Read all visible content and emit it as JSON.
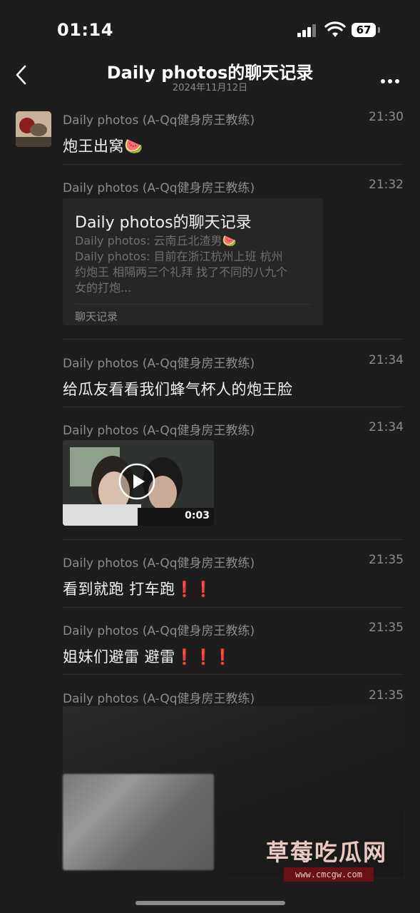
{
  "status": {
    "time": "01:14",
    "battery": "67"
  },
  "header": {
    "title": "Daily photos的聊天记录",
    "date": "2024年11月12日"
  },
  "messages": [
    {
      "name": "Daily photos (A-Qq健身房王教练)",
      "time": "21:30",
      "text": "炮王出窝🍉"
    },
    {
      "name": "Daily photos (A-Qq健身房王教练)",
      "time": "21:32",
      "card": {
        "title": "Daily photos的聊天记录",
        "line1": "Daily photos: 云南丘北渣男🍉",
        "line2": "Daily photos: 目前在浙江杭州上班 杭州",
        "line3": "约炮王 相隔两三个礼拜 找了不同的八九个",
        "line4": "女的打炮...",
        "footer": "聊天记录"
      }
    },
    {
      "name": "Daily photos (A-Qq健身房王教练)",
      "time": "21:34",
      "text": "给瓜友看看我们蜂气杯人的炮王脸"
    },
    {
      "name": "Daily photos (A-Qq健身房王教练)",
      "time": "21:34",
      "video_duration": "0:03"
    },
    {
      "name": "Daily photos (A-Qq健身房王教练)",
      "time": "21:35",
      "text": "看到就跑 打车跑❗️❗️"
    },
    {
      "name": "Daily photos (A-Qq健身房王教练)",
      "time": "21:35",
      "text": "姐妹们避雷 避雷❗️❗️❗️"
    },
    {
      "name": "Daily photos (A-Qq健身房王教练)",
      "time": "21:35"
    }
  ],
  "watermark": {
    "text": "草莓吃瓜网",
    "url": "www.cmcgw.com"
  },
  "icons": [
    "back-chevron-icon",
    "more-dots-icon",
    "play-icon",
    "signal-icon",
    "wifi-icon",
    "battery-icon"
  ]
}
